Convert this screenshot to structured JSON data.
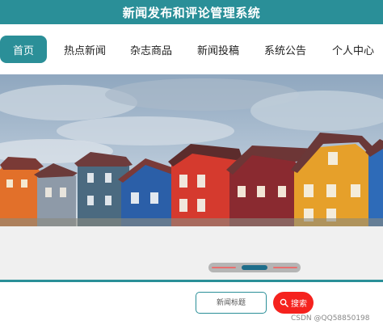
{
  "app": {
    "title": "新闻发布和评论管理系统"
  },
  "nav": {
    "items": [
      {
        "label": "首页",
        "active": true
      },
      {
        "label": "热点新闻",
        "active": false
      },
      {
        "label": "杂志商品",
        "active": false
      },
      {
        "label": "新闻投稿",
        "active": false
      },
      {
        "label": "系统公告",
        "active": false
      },
      {
        "label": "个人中心",
        "active": false
      }
    ]
  },
  "banner": {
    "image": "colorful-houses-photo",
    "carousel_active_index": 1,
    "carousel_count": 3
  },
  "search": {
    "placeholder": "新闻标题",
    "button_label": "搜索",
    "button_icon": "search-icon"
  },
  "watermark": {
    "text": "CSDN @QQ58850198"
  },
  "colors": {
    "primary": "#2a8f98",
    "search_button": "#f5221e"
  }
}
